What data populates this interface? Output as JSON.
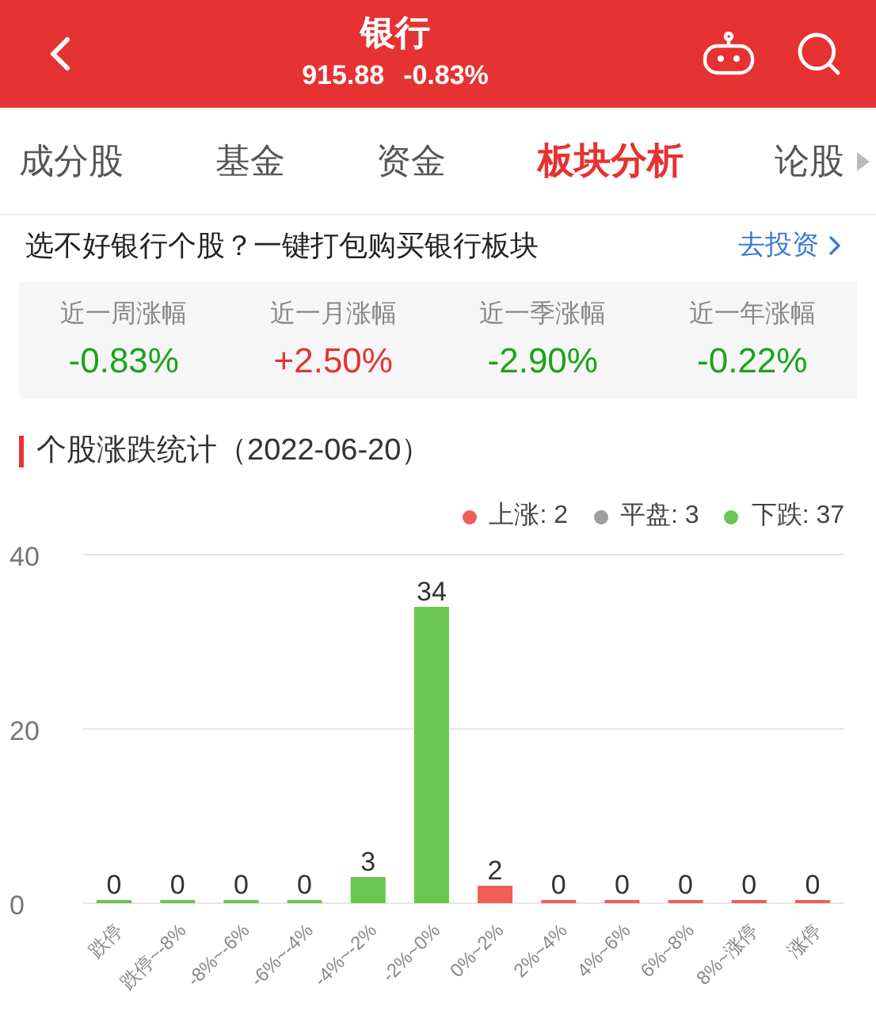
{
  "header": {
    "title": "银行",
    "price": "915.88",
    "change": "-0.83%"
  },
  "tabs": [
    {
      "label": "成分股",
      "selected": false
    },
    {
      "label": "基金",
      "selected": false
    },
    {
      "label": "资金",
      "selected": false
    },
    {
      "label": "板块分析",
      "selected": true
    },
    {
      "label": "论股",
      "selected": false
    }
  ],
  "promo": {
    "text": "选不好银行个股？一键打包购买银行板块",
    "link": "去投资"
  },
  "periods": [
    {
      "label": "近一周涨幅",
      "value": "-0.83%",
      "color": "#1aa31a"
    },
    {
      "label": "近一月涨幅",
      "value": "+2.50%",
      "color": "#e63232"
    },
    {
      "label": "近一季涨幅",
      "value": "-2.90%",
      "color": "#1aa31a"
    },
    {
      "label": "近一年涨幅",
      "value": "-0.22%",
      "color": "#1aa31a"
    }
  ],
  "section_title": "个股涨跌统计（2022-06-20）",
  "legend": [
    {
      "label": "上涨: 2",
      "color": "#ef5f57"
    },
    {
      "label": "平盘: 3",
      "color": "#9e9e9e"
    },
    {
      "label": "下跌: 37",
      "color": "#6cc54f"
    }
  ],
  "chart_data": {
    "type": "bar",
    "categories": [
      "跌停",
      "跌停~-8%",
      "-8%~-6%",
      "-6%~-4%",
      "-4%~-2%",
      "-2%~0%",
      "0%~2%",
      "2%~4%",
      "4%~6%",
      "6%~8%",
      "8%~涨停",
      "涨停"
    ],
    "series": [
      {
        "color": "#6cc54f",
        "values": [
          0,
          0,
          0,
          0,
          3,
          34,
          null,
          null,
          null,
          null,
          null,
          null
        ]
      },
      {
        "color": "#ef5f57",
        "values": [
          null,
          null,
          null,
          null,
          null,
          null,
          2,
          0,
          0,
          0,
          0,
          0
        ]
      }
    ],
    "ylim": [
      0,
      40
    ],
    "yticks": [
      0,
      20,
      40
    ],
    "data_labels": true
  }
}
